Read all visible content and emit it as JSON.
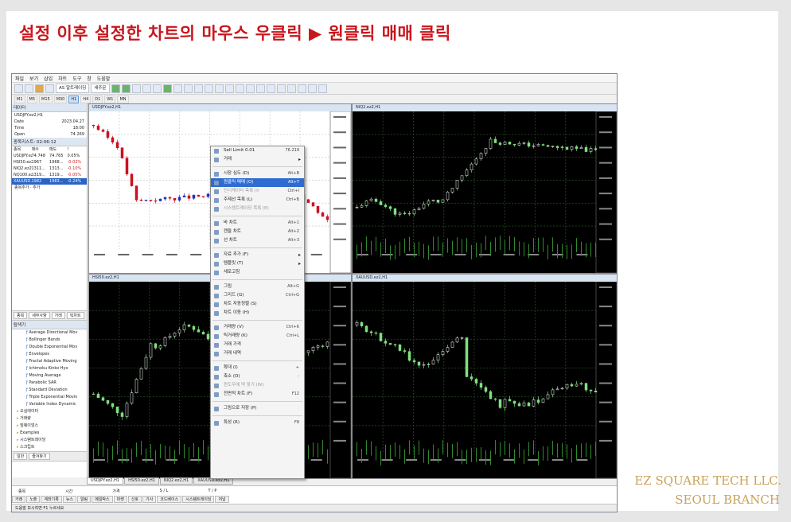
{
  "headline": "설정 이후 설정한 차트의 마우스 우클릭 ▶ 원클릭 매매 클릭",
  "credit": {
    "line1": "EZ SQUARE TECH LLC.",
    "line2": "SEOUL BRANCH"
  },
  "colors": {
    "headline": "#c8161d",
    "credit": "#c9a25a",
    "menu_highlight": "#2f6cd1",
    "candle_up": "#7fe07f",
    "chart_bg_dark": "#000000"
  },
  "app": {
    "menu": [
      "파일",
      "보기",
      "삽입",
      "차트",
      "도구",
      "창",
      "도움말"
    ],
    "toolbar": {
      "auto_trade": "AS 알트레이딩",
      "new_order": "새주문"
    },
    "timeframes": [
      "M1",
      "M5",
      "M15",
      "M30",
      "H1",
      "H4",
      "D1",
      "W1",
      "MN"
    ],
    "active_timeframe": "H1"
  },
  "data_window": {
    "title": "데이터",
    "symbol": "USDJPY.ez2,H1",
    "rows": [
      {
        "k": "Date",
        "v": "2023.04.27"
      },
      {
        "k": "Time",
        "v": "18:00"
      },
      {
        "k": "Open",
        "v": "74.269"
      }
    ]
  },
  "market_watch": {
    "title": "종목리스트: 02:06:12",
    "headers": [
      "종목",
      "매수",
      "매도",
      "!"
    ],
    "rows": [
      [
        "USDJPY.ez2",
        "74.748",
        "74.765",
        "0.05%"
      ],
      [
        "HSI50.ez2",
        "1967",
        "1968...",
        "-0.02%"
      ],
      [
        "NIQ2.ez2",
        "1311...",
        "1313...",
        "-0.10%"
      ],
      [
        "NQ100.ez2",
        "1319...",
        "1319...",
        "-0.05%"
      ],
      [
        "XAUUSD.ez2",
        "1982",
        "1983...",
        "-0.24%"
      ]
    ],
    "footer": "종목추가 · 추가",
    "tabs": [
      "종목",
      "세부사항",
      "거래",
      "틱차트"
    ]
  },
  "navigator": {
    "title": "탐색기",
    "indicators": [
      "Average Directional Mov",
      "Bollinger Bands",
      "Double Exponential Mov",
      "Envelopes",
      "Fractal Adaptive Moving",
      "Ichimoku Kinko Hyo",
      "Moving Average",
      "Parabolic SAR",
      "Standard Deviation",
      "Triple Exponential Movin",
      "Variable Index Dynamic"
    ],
    "folders": [
      "오실레이터",
      "거래량",
      "빌웨이엄스",
      "Examples",
      "시스템트레이딩",
      "스크립트"
    ],
    "tabs": [
      "일반",
      "즐겨찾기"
    ]
  },
  "charts": [
    {
      "title": "USDJPY.ez2,H1",
      "info": "USDJPY.ez2,H1  Yen Deals 10"
    },
    {
      "title": "HSI50.ez2,H1",
      "info": "HSI50.ez2,H1  Hang Seng 50 Index"
    },
    {
      "title": "NIQ2.ez2,H1",
      "info": "NIQ2.ez2,H1  Nikkei 225"
    },
    {
      "title": "XAUUSD.ez2,H1",
      "info": "XAUUSD.ez2,H1  Gold vs US Dollar"
    }
  ],
  "chart_tabs": [
    "USDJPY.ez2,H1",
    "HSI50.ez2,H1",
    "NIQ2.ez2,H1",
    "XAUUSD.ez2,H1"
  ],
  "context_menu": {
    "items": [
      {
        "label": "Sell Limit 0.01",
        "shortcut": "76.219",
        "kind": "normal"
      },
      {
        "label": "거래",
        "shortcut": "",
        "kind": "submenu"
      },
      {
        "kind": "sep"
      },
      {
        "label": "시장 심도 (D)",
        "shortcut": "Alt+B",
        "kind": "normal"
      },
      {
        "label": "원클릭 매매 (O)",
        "shortcut": "Alt+T",
        "kind": "highlight"
      },
      {
        "label": "인디케이터 목록 (I)",
        "shortcut": "Ctrl+I",
        "kind": "disabled"
      },
      {
        "label": "주제선 목록 (L)",
        "shortcut": "Ctrl+B",
        "kind": "normal"
      },
      {
        "label": "시스템트레이딩 목록 (E)",
        "shortcut": "",
        "kind": "disabled"
      },
      {
        "kind": "sep"
      },
      {
        "label": "바 차트",
        "shortcut": "Alt+1",
        "kind": "normal"
      },
      {
        "label": "캔들 차트",
        "shortcut": "Alt+2",
        "kind": "normal"
      },
      {
        "label": "선 차트",
        "shortcut": "Alt+3",
        "kind": "normal"
      },
      {
        "kind": "sep"
      },
      {
        "label": "자료 추가 (F)",
        "shortcut": "",
        "kind": "submenu"
      },
      {
        "label": "템플릿 (T)",
        "shortcut": "",
        "kind": "submenu"
      },
      {
        "label": "새로고침",
        "shortcut": "",
        "kind": "normal"
      },
      {
        "kind": "sep"
      },
      {
        "label": "그림",
        "shortcut": "Alt+G",
        "kind": "normal"
      },
      {
        "label": "그리드 (G)",
        "shortcut": "Ctrl+G",
        "kind": "normal"
      },
      {
        "label": "차트 자동정렬 (S)",
        "shortcut": "",
        "kind": "normal"
      },
      {
        "label": "차트 이동 (H)",
        "shortcut": "",
        "kind": "normal"
      },
      {
        "kind": "sep"
      },
      {
        "label": "거래량 (V)",
        "shortcut": "Ctrl+K",
        "kind": "normal"
      },
      {
        "label": "틱거래량 (K)",
        "shortcut": "Ctrl+L",
        "kind": "normal"
      },
      {
        "label": "거래 가격",
        "shortcut": "",
        "kind": "normal"
      },
      {
        "label": "거래 내역",
        "shortcut": "",
        "kind": "normal"
      },
      {
        "kind": "sep"
      },
      {
        "label": "확대 (I)",
        "shortcut": "+",
        "kind": "normal"
      },
      {
        "label": "축소 (O)",
        "shortcut": "-",
        "kind": "normal"
      },
      {
        "label": "윈도우에 딱 맞기 (W)",
        "shortcut": "",
        "kind": "disabled"
      },
      {
        "label": "전면적 차트 (F)",
        "shortcut": "F12",
        "kind": "normal"
      },
      {
        "kind": "sep"
      },
      {
        "label": "그림으로 저장 (P)",
        "shortcut": "",
        "kind": "normal"
      },
      {
        "kind": "sep"
      },
      {
        "label": "특성 (R)",
        "shortcut": "F8",
        "kind": "normal"
      }
    ]
  },
  "terminal": {
    "headers": [
      "종목",
      "시간",
      "가격",
      "S / L",
      "T / P"
    ],
    "tabs": [
      "거래",
      "노출",
      "계좌기록",
      "뉴스",
      "알림",
      "메일박스",
      "마켓",
      "신호",
      "기사",
      "코드베이스",
      "시스템트레이딩",
      "저널"
    ]
  },
  "status": "도움말 보시려면 F1 누르세요"
}
